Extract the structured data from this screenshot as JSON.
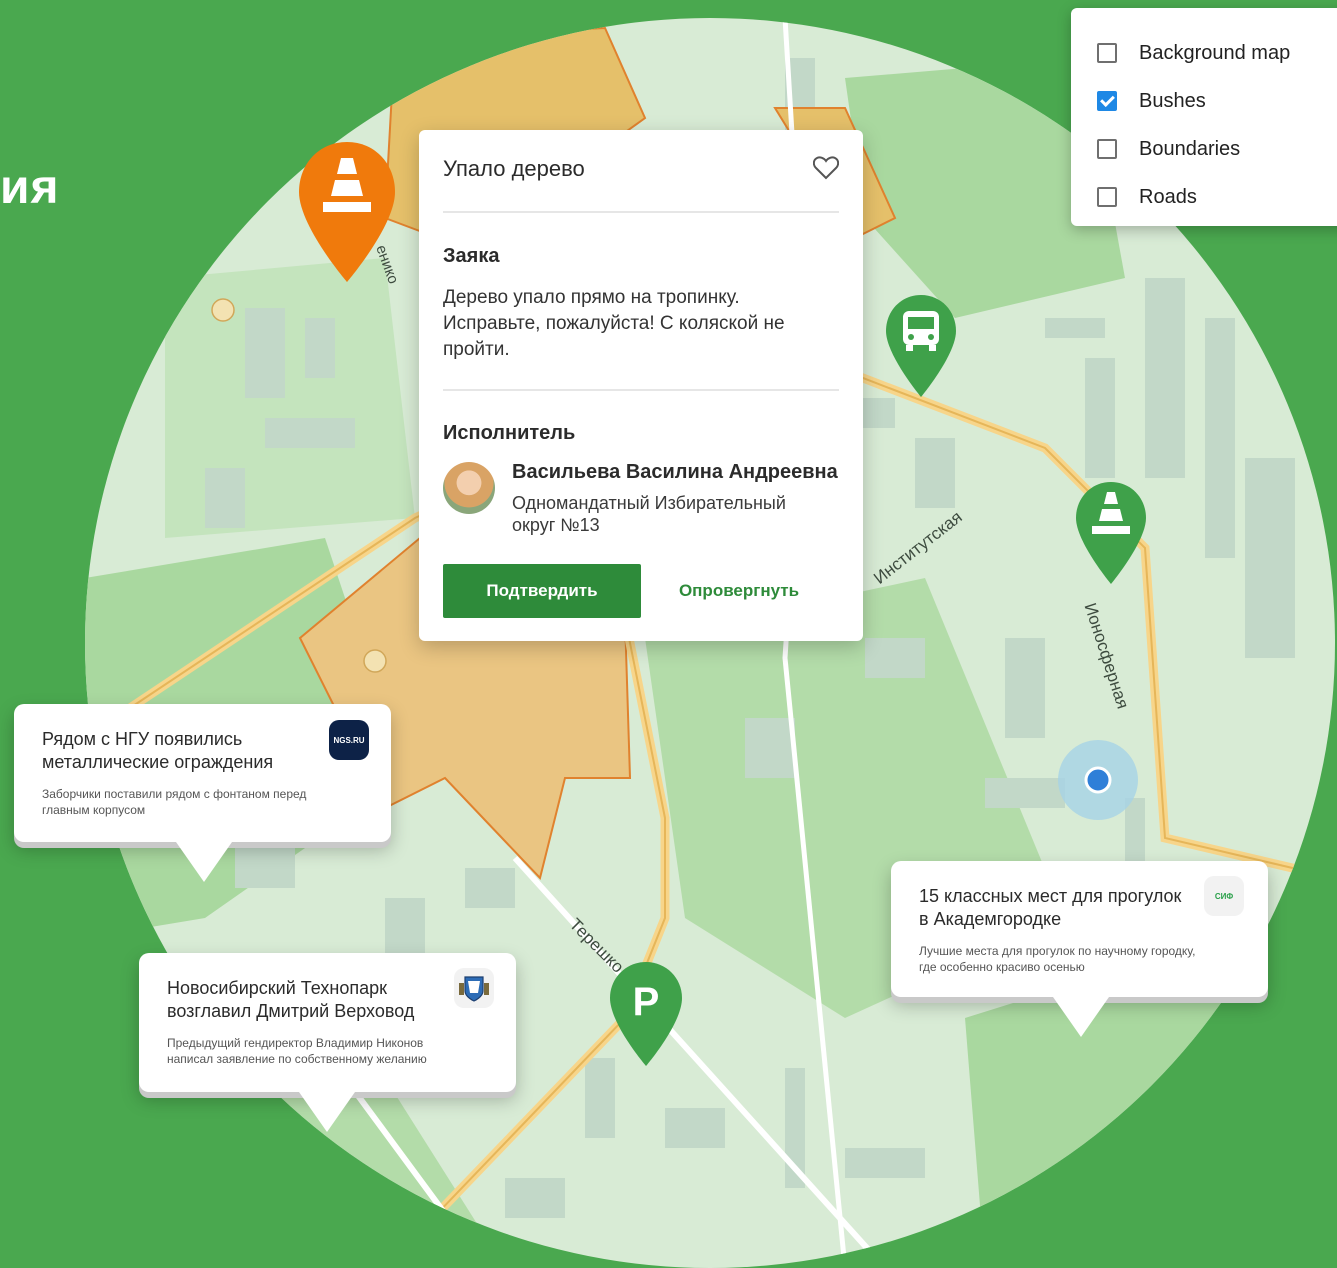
{
  "background": {
    "partial_title": "ия"
  },
  "layers_panel": {
    "items": [
      {
        "label": "Background map",
        "checked": false
      },
      {
        "label": "Bushes",
        "checked": true
      },
      {
        "label": "Boundaries",
        "checked": false
      },
      {
        "label": "Roads",
        "checked": false
      }
    ]
  },
  "map": {
    "streets": {
      "institutskaya": "Институтская",
      "ionosfernaya": "Ионосферная",
      "tereshkova": "Терешко",
      "top_street": "енико"
    }
  },
  "issue_card": {
    "title": "Упало дерево",
    "request_heading": "Заяка",
    "request_text": "Дерево упало прямо на тропинку. Исправьте, пожалуйста! С коляской не пройти.",
    "executor_heading": "Исполнитель",
    "executor_name": "Васильева Василина Андреевна",
    "executor_role": "Одномандатный Избирательный округ №13",
    "confirm_label": "Подтвердить",
    "refute_label": "Опровергнуть"
  },
  "news": [
    {
      "title": "Рядом с НГУ появились металлические ограждения",
      "subtitle": "Заборчики поставили рядом с фонтаном перед главным корпусом",
      "source": "NGS.RU",
      "source_color": "#0d2247"
    },
    {
      "title": "Новосибирский Технопарк возглавил Дмитрий Верховод",
      "subtitle": "Предыдущий гендиректор Владимир Никонов написал заявление по собственному желанию",
      "source": "coat-of-arms"
    },
    {
      "title": "15 классных мест для прогулок в Академгородке",
      "subtitle": "Лучшие места для прогулок по научному городку, где особенно красиво осенью",
      "source": "СИФ",
      "source_color": "#2aa04a"
    }
  ],
  "pins": {
    "traffic_cone_orange": "traffic-cone-icon",
    "bus": "bus-icon",
    "traffic_cone_green": "traffic-cone-icon",
    "parking": "P"
  },
  "colors": {
    "brand_green": "#2e8b3a",
    "background_green": "#4aa84f",
    "pin_orange": "#f07a0c",
    "pin_green": "#3fa14a",
    "checkbox_blue": "#1e88e5"
  }
}
